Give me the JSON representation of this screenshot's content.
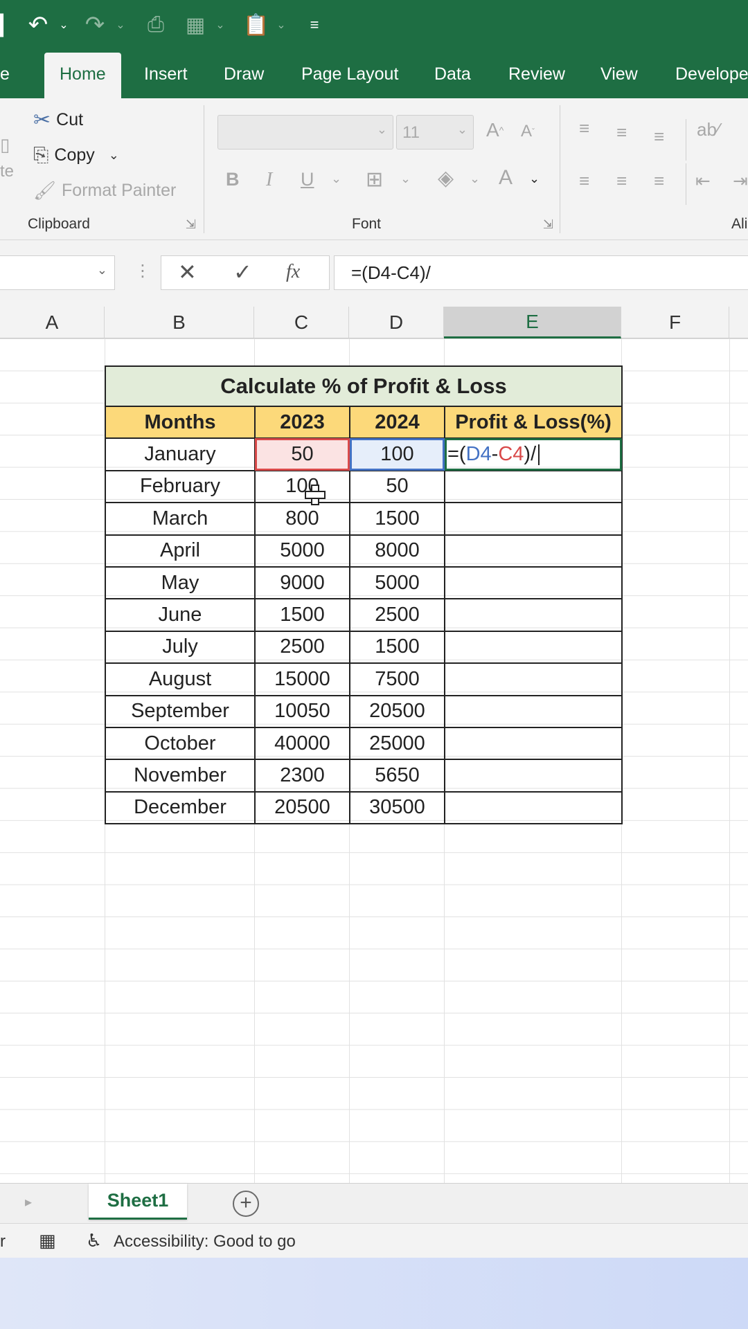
{
  "quick_access": {
    "save_icon": "save-icon",
    "undo_icon": "undo-icon",
    "redo_icon": "redo-icon",
    "print_preview_icon": "print-preview-icon",
    "format_icon": "format-icon",
    "paste_icon": "paste-icon",
    "customize_icon": "customize-icon"
  },
  "ribbon_tabs": {
    "file": "e",
    "home": "Home",
    "insert": "Insert",
    "draw": "Draw",
    "page_layout": "Page Layout",
    "data": "Data",
    "review": "Review",
    "view": "View",
    "developer": "Develope"
  },
  "clipboard": {
    "paste_label": "te",
    "cut": "Cut",
    "copy": "Copy",
    "format_painter": "Format Painter",
    "group_label": "Clipboard"
  },
  "font": {
    "font_name": "",
    "font_size": "11",
    "bold": "B",
    "italic": "I",
    "underline": "U",
    "font_color": "A",
    "increase_size": "A",
    "decrease_size": "A",
    "group_label": "Font"
  },
  "alignment": {
    "group_label": "Ali"
  },
  "formula_bar": {
    "name_box": "",
    "cancel": "✕",
    "enter": "✓",
    "fx": "fx",
    "formula": "=(D4-C4)/"
  },
  "columns": [
    "A",
    "B",
    "C",
    "D",
    "E",
    "F"
  ],
  "table": {
    "title": "Calculate % of Profit & Loss",
    "headers": [
      "Months",
      "2023",
      "2024",
      "Profit & Loss(%)"
    ],
    "rows": [
      [
        "January",
        "50",
        "100"
      ],
      [
        "February",
        "100",
        "50"
      ],
      [
        "March",
        "800",
        "1500"
      ],
      [
        "April",
        "5000",
        "8000"
      ],
      [
        "May",
        "9000",
        "5000"
      ],
      [
        "June",
        "1500",
        "2500"
      ],
      [
        "July",
        "2500",
        "1500"
      ],
      [
        "August",
        "15000",
        "7500"
      ],
      [
        "September",
        "10050",
        "20500"
      ],
      [
        "October",
        "40000",
        "25000"
      ],
      [
        "November",
        "2300",
        "5650"
      ],
      [
        "December",
        "20500",
        "30500"
      ]
    ],
    "active_cell_formula": {
      "prefix": "=(",
      "ref1": "D4",
      "minus": "-",
      "ref2": "C4",
      "suffix": ")/"
    }
  },
  "sheets": {
    "active": "Sheet1",
    "add": "+"
  },
  "status": {
    "left_text": "r",
    "accessibility": "Accessibility: Good to go"
  }
}
